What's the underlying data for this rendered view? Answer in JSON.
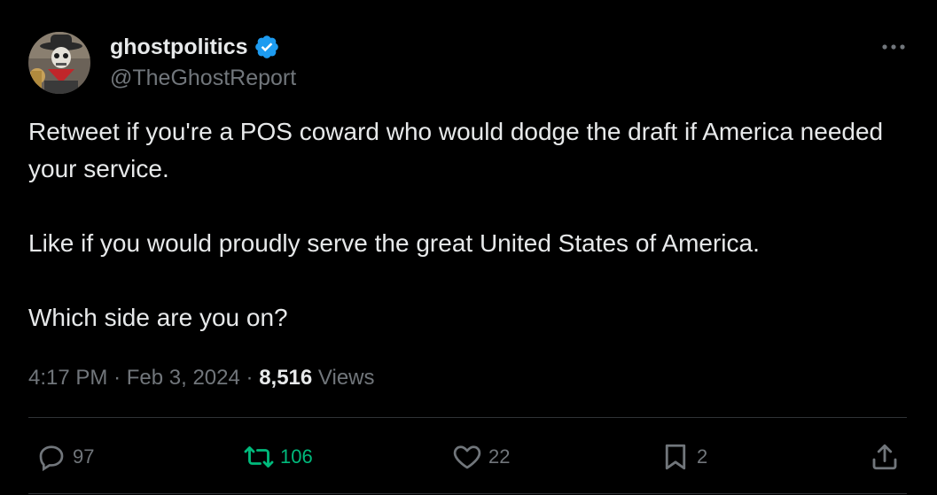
{
  "author": {
    "display_name": "ghostpolitics",
    "handle": "@TheGhostReport",
    "verified": true,
    "avatar_icon": "skeleton-cowboy-avatar"
  },
  "tweet": {
    "paragraphs": [
      "Retweet if you're a POS coward who would dodge the draft if America needed your service.",
      "Like if you would proudly serve the great United States of America.",
      "Which side are you on?"
    ]
  },
  "meta": {
    "time": "4:17 PM",
    "separator": "·",
    "date": "Feb 3, 2024",
    "views_count": "8,516",
    "views_label": "Views"
  },
  "actions": {
    "replies": "97",
    "retweets": "106",
    "likes": "22",
    "bookmarks": "2"
  },
  "colors": {
    "background": "#000000",
    "text_primary": "#e7e9ea",
    "text_secondary": "#71767b",
    "verified_blue": "#1d9bf0",
    "retweet_green": "#00ba7c",
    "divider": "#2f3336"
  }
}
